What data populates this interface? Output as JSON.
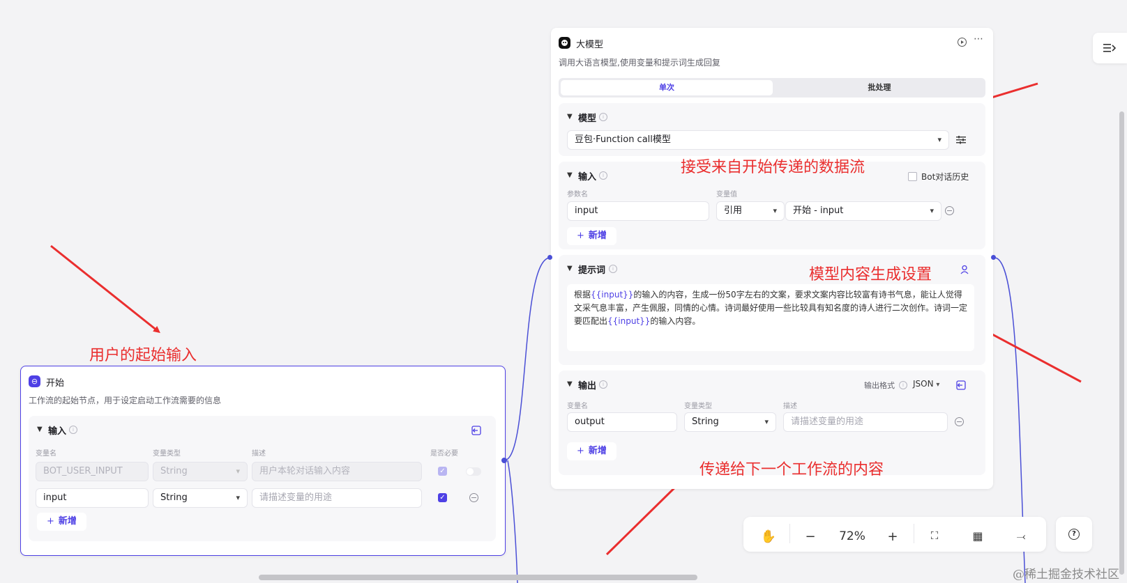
{
  "llm_node": {
    "title": "大模型",
    "description": "调用大语言模型,使用变量和提示词生成回复",
    "tabs": [
      {
        "label": "单次",
        "active": true
      },
      {
        "label": "批处理",
        "active": false
      }
    ],
    "model_section": {
      "title": "模型",
      "model_value": "豆包·Function call模型"
    },
    "input_section": {
      "title": "输入",
      "history_label": "Bot对话历史",
      "col_param": "参数名",
      "col_value": "变量值",
      "rows": [
        {
          "name": "input",
          "ref_type": "引用",
          "ref_value": "开始 - input"
        }
      ],
      "add_label": "新增"
    },
    "prompt_section": {
      "title": "提示词",
      "text_parts": [
        "根据",
        "{{input}}",
        "的输入的内容，生成一份50字左右的文案，要求文案内容比较富有诗书气息，能让人觉得文采气息丰富，产生佩服，同情的心情。诗词最好使用一些比较具有知名度的诗人进行二次创作。诗词一定要匹配出",
        "{{input}}",
        "的输入内容。"
      ]
    },
    "output_section": {
      "title": "输出",
      "format_label": "输出格式",
      "format_value": "JSON",
      "col_name": "变量名",
      "col_type": "变量类型",
      "col_desc": "描述",
      "rows": [
        {
          "name": "output",
          "type": "String",
          "desc_placeholder": "请描述变量的用途"
        }
      ],
      "add_label": "新增"
    }
  },
  "start_node": {
    "title": "开始",
    "description": "工作流的起始节点，用于设定启动工作流需要的信息",
    "input_section": {
      "title": "输入",
      "col_name": "变量名",
      "col_type": "变量类型",
      "col_desc": "描述",
      "col_required": "是否必要",
      "rows": [
        {
          "name": "BOT_USER_INPUT",
          "type": "String",
          "desc": "用户本轮对话输入内容",
          "required": true,
          "disabled": true
        },
        {
          "name": "input",
          "type": "String",
          "desc": "请描述变量的用途",
          "required": true,
          "disabled": false
        }
      ],
      "add_label": "新增"
    }
  },
  "annotations": {
    "a1": "接受来自开始传递的数据流",
    "a2": "模型内容生成设置",
    "a3": "用户的起始输入",
    "a4": "传递给下一个工作流的内容"
  },
  "toolbar": {
    "zoom": "72%"
  },
  "watermark": "@稀土掘金技术社区",
  "colors": {
    "accent": "#4e40e5",
    "annotation": "#ea2e2e",
    "edge": "#4a4fd6"
  }
}
